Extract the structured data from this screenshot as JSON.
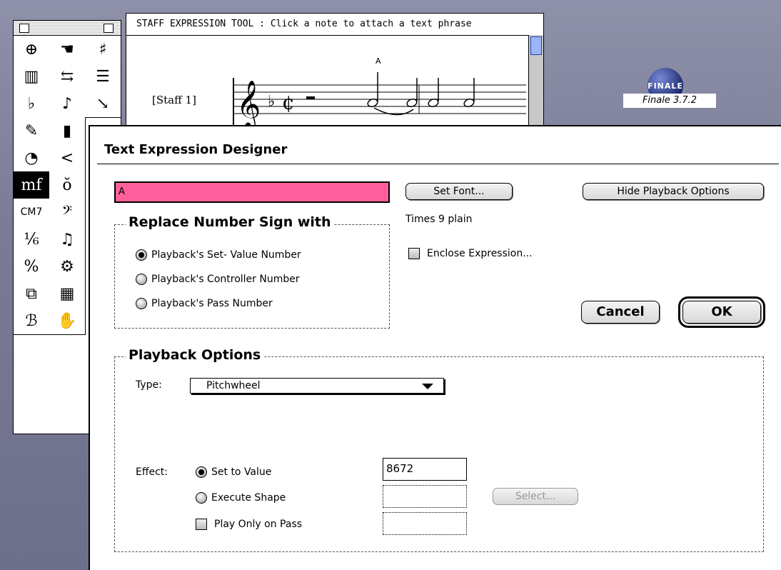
{
  "app": {
    "name": "Finale",
    "version_label": "Finale 3.7.2",
    "logo_text": "FINALE"
  },
  "staff_window": {
    "message": "STAFF EXPRESSION TOOL : Click a note to attach a text phrase",
    "staff_label": "[Staff 1]",
    "note_mark": "A"
  },
  "palette": {
    "tools": [
      {
        "icon": "zoom-icon",
        "glyph": "⊕"
      },
      {
        "icon": "hand-icon",
        "glyph": "☚"
      },
      {
        "icon": "staff-tool-icon",
        "glyph": "♯"
      },
      {
        "icon": "measure-tool-icon",
        "glyph": "▥"
      },
      {
        "icon": "spacing-tool-icon",
        "glyph": "⇆"
      },
      {
        "icon": "alignment-tool-icon",
        "glyph": "☰"
      },
      {
        "icon": "key-signature-icon",
        "glyph": "♭"
      },
      {
        "icon": "note-icon",
        "glyph": "♪"
      },
      {
        "icon": "speedy-entry-icon",
        "glyph": "↘"
      },
      {
        "icon": "simple-entry-icon",
        "glyph": "✎"
      },
      {
        "icon": "midi-tool-icon",
        "glyph": "▮"
      },
      {
        "icon": "hidden",
        "glyph": ""
      },
      {
        "icon": "articulation-icon",
        "glyph": "◔"
      },
      {
        "icon": "hairpin-icon",
        "glyph": "<"
      },
      {
        "icon": "hidden",
        "glyph": ""
      },
      {
        "icon": "expression-icon",
        "glyph": "mf"
      },
      {
        "icon": "accent-icon",
        "glyph": "ŏ"
      },
      {
        "icon": "hidden",
        "glyph": ""
      },
      {
        "icon": "chord-icon",
        "glyph": "CM7"
      },
      {
        "icon": "bass-clef-icon",
        "glyph": "𝄢"
      },
      {
        "icon": "hidden",
        "glyph": ""
      },
      {
        "icon": "tuplet-icon",
        "glyph": "⅙"
      },
      {
        "icon": "smart-shape-icon",
        "glyph": "♫"
      },
      {
        "icon": "hidden",
        "glyph": ""
      },
      {
        "icon": "percent-icon",
        "glyph": "%"
      },
      {
        "icon": "special-tools-icon",
        "glyph": "⚙"
      },
      {
        "icon": "hidden",
        "glyph": ""
      },
      {
        "icon": "page-layout-icon",
        "glyph": "⧉"
      },
      {
        "icon": "mass-edit-icon",
        "glyph": "▦"
      },
      {
        "icon": "hidden",
        "glyph": ""
      },
      {
        "icon": "text-tool-icon",
        "glyph": "ℬ"
      },
      {
        "icon": "graphics-tool-icon",
        "glyph": "✋"
      },
      {
        "icon": "hidden",
        "glyph": ""
      }
    ]
  },
  "dialog": {
    "title": "Text Expression Designer",
    "text_value": "A",
    "set_font_label": "Set Font...",
    "hide_playback_label": "Hide Playback Options",
    "font_description": "Times 9 plain",
    "enclose_label": "Enclose Expression...",
    "cancel_label": "Cancel",
    "ok_label": "OK",
    "replace_group": {
      "title": "Replace Number Sign with",
      "options": [
        "Playback's Set- Value Number",
        "Playback's Controller Number",
        "Playback's Pass Number"
      ],
      "selected": 0
    },
    "playback": {
      "title": "Playback Options",
      "type_label": "Type:",
      "type_value": "Pitchwheel",
      "effect_label": "Effect:",
      "set_value_label": "Set to Value",
      "execute_shape_label": "Execute Shape",
      "play_only_label": "Play Only on Pass",
      "value": "8672",
      "select_label": "Select..."
    }
  }
}
